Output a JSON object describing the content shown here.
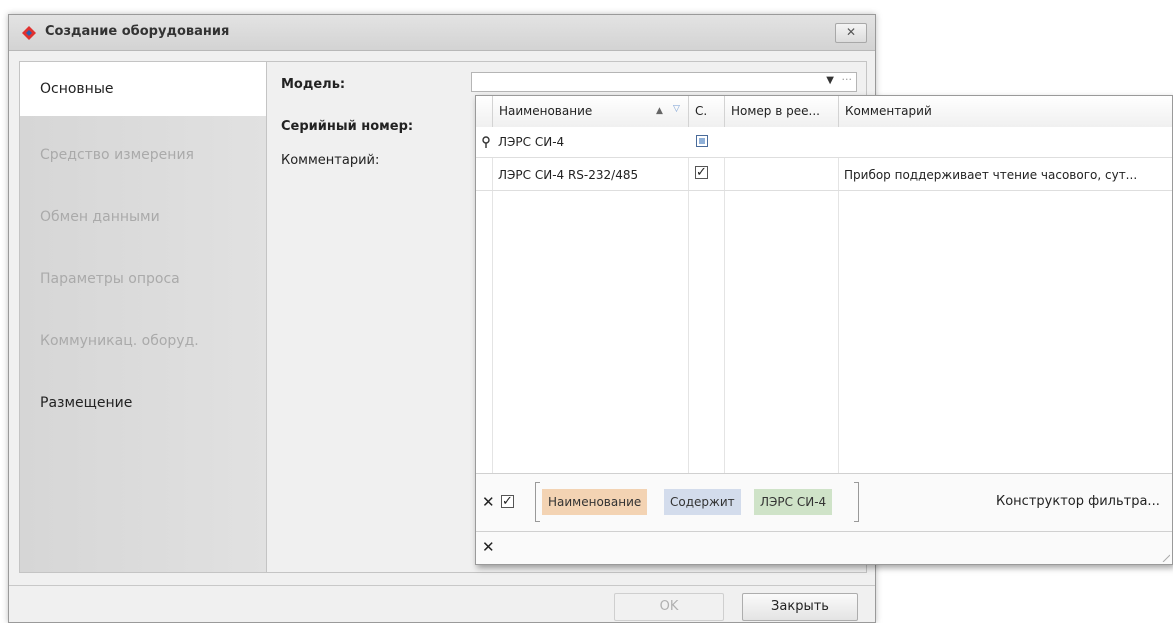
{
  "window": {
    "title": "Создание оборудования",
    "close_glyph": "✕"
  },
  "sidebar": {
    "items": [
      {
        "label": "Основные",
        "state": "active"
      },
      {
        "label": "Средство измерения",
        "state": "disabled"
      },
      {
        "label": "Обмен данными",
        "state": "disabled"
      },
      {
        "label": "Параметры опроса",
        "state": "disabled"
      },
      {
        "label": "Коммуникац. оборуд.",
        "state": "disabled"
      },
      {
        "label": "Размещение",
        "state": "enabled"
      }
    ]
  },
  "form": {
    "model_label": "Модель:",
    "serial_label": "Серийный номер:",
    "comment_label": "Комментарий:",
    "model_value": "",
    "dots": "···"
  },
  "grid": {
    "columns": [
      {
        "label": "Наименование"
      },
      {
        "label": "С."
      },
      {
        "label": "Номер в рее..."
      },
      {
        "label": "Комментарий"
      }
    ],
    "filter_row": {
      "name": "ЛЭРС СИ-4",
      "contains_state": "indeterminate"
    },
    "rows": [
      {
        "name": "ЛЭРС СИ-4 RS-232/485",
        "checked": true,
        "register_no": "",
        "comment": "Прибор поддерживает чтение часового, сут..."
      }
    ]
  },
  "filter_panel": {
    "field": "Наименование",
    "operator": "Содержит",
    "value": "ЛЭРС СИ-4",
    "enabled": true,
    "builder_link": "Конструктор фильтра..."
  },
  "footer": {
    "ok_label": "OK",
    "close_label": "Закрыть"
  },
  "colors": {
    "token_field": "#f3d3b3",
    "token_operator": "#d3dcec",
    "token_value": "#cfe3c8",
    "icon_red": "#e0312f",
    "icon_blue": "#2b5fae"
  }
}
